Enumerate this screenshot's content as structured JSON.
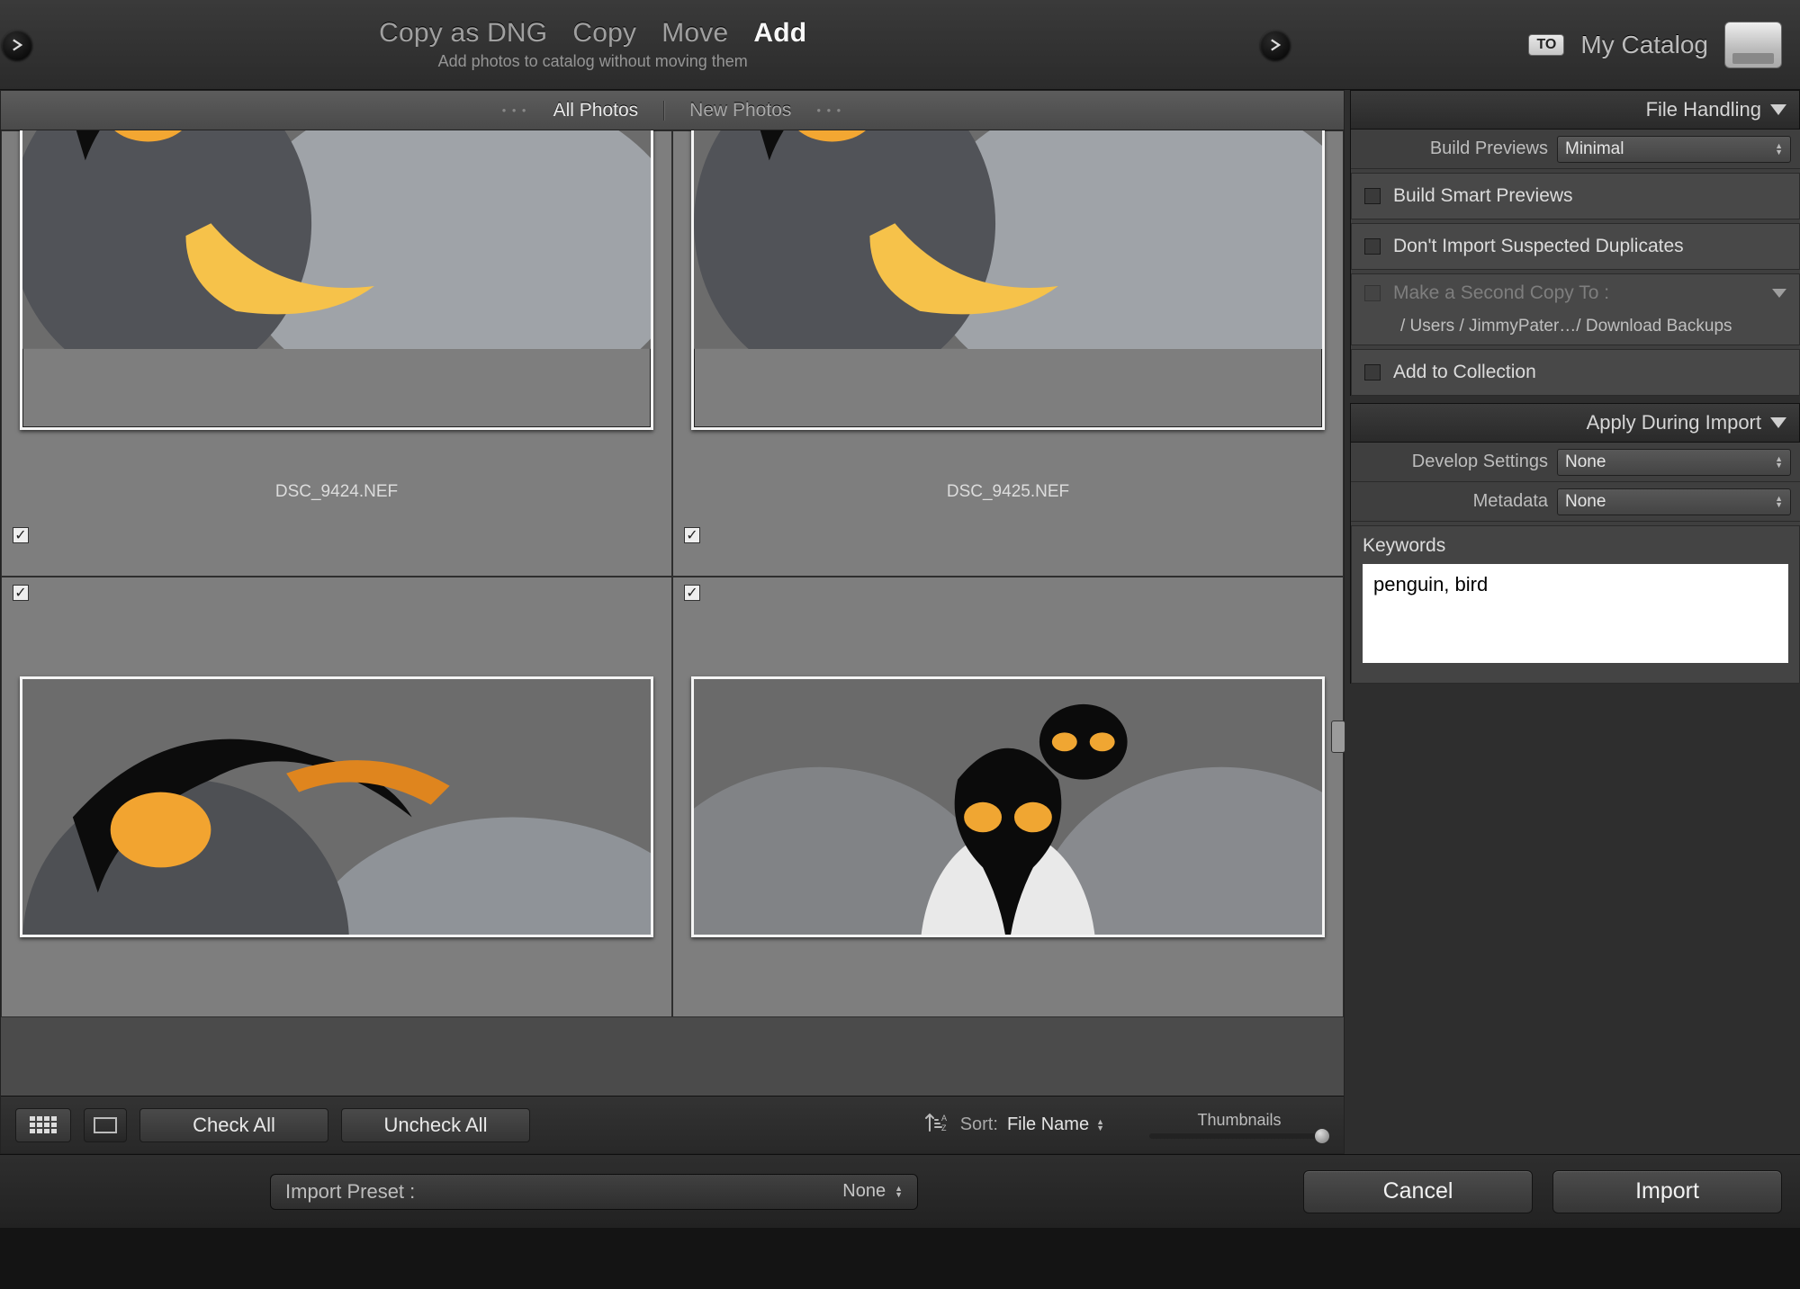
{
  "topbar": {
    "modes": {
      "dng": "Copy as DNG",
      "copy": "Copy",
      "move": "Move",
      "add": "Add"
    },
    "subtitle": "Add photos to catalog without moving them",
    "dest_badge": "TO",
    "dest_name": "My Catalog"
  },
  "filterbar": {
    "all": "All Photos",
    "new": "New Photos"
  },
  "thumbs": [
    {
      "filename": "DSC_9424.NEF"
    },
    {
      "filename": "DSC_9425.NEF"
    }
  ],
  "file_handling": {
    "title": "File Handling",
    "build_previews_label": "Build Previews",
    "build_previews_value": "Minimal",
    "smart_previews": "Build Smart Previews",
    "dupes": "Don't Import Suspected Duplicates",
    "second_copy": "Make a Second Copy To :",
    "second_copy_path": "/ Users / JimmyPater…/ Download Backups",
    "add_collection": "Add to Collection"
  },
  "apply_during": {
    "title": "Apply During Import",
    "develop_label": "Develop Settings",
    "develop_value": "None",
    "metadata_label": "Metadata",
    "metadata_value": "None",
    "keywords_label": "Keywords",
    "keywords_value": "penguin, bird"
  },
  "gridfoot": {
    "check_all": "Check All",
    "uncheck_all": "Uncheck All",
    "sort_label": "Sort:",
    "sort_value": "File Name",
    "thumbnails": "Thumbnails"
  },
  "bottom": {
    "preset_label": "Import Preset :",
    "preset_value": "None",
    "cancel": "Cancel",
    "import": "Import"
  }
}
